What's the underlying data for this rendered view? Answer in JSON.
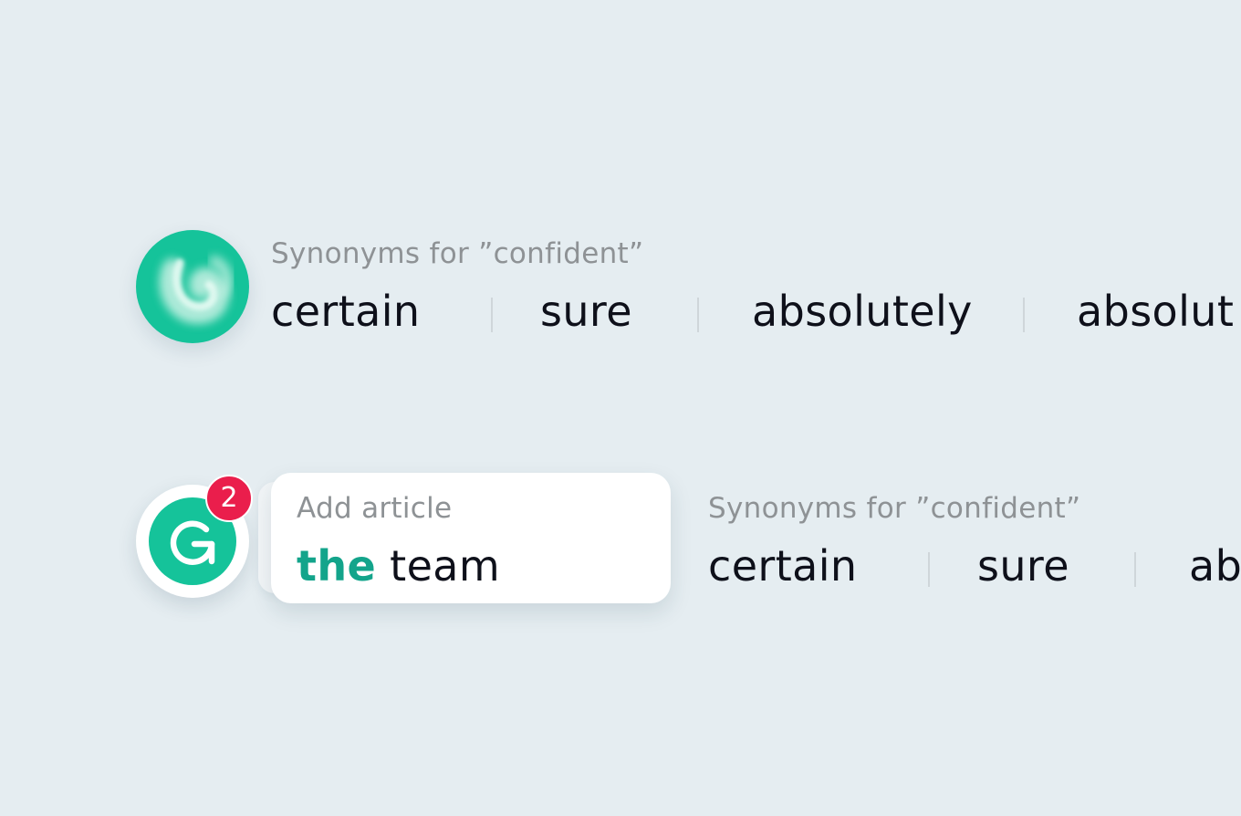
{
  "colors": {
    "background": "#e5edf1",
    "brand_green": "#15c39a",
    "highlight_green": "#13a48b",
    "badge_red": "#ea1e4c",
    "muted_text": "#8e9295",
    "main_text": "#0e101a"
  },
  "row1": {
    "logo_icon": "grammarly-blurred-logo-icon",
    "synonyms": {
      "title": "Synonyms for ”confident”",
      "words": [
        "certain",
        "sure",
        "absolutely",
        "absolut"
      ]
    }
  },
  "row2": {
    "logo_icon": "grammarly-g-logo-icon",
    "badge_count": "2",
    "card": {
      "label": "Add article",
      "highlight": "the",
      "rest": " team"
    },
    "synonyms": {
      "title": "Synonyms for ”confident”",
      "words": [
        "certain",
        "sure",
        "ab"
      ]
    }
  }
}
